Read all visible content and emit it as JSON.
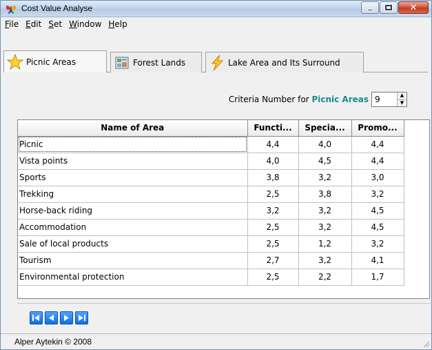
{
  "window": {
    "title": "Cost Value Analyse",
    "title_icon": "butterfly-app-icon",
    "minimize_glyph": "",
    "maximize_glyph": "",
    "close_glyph": "✕"
  },
  "menu": [
    {
      "label": "File",
      "mnemonic": "F",
      "rest": "ile"
    },
    {
      "label": "Edit",
      "mnemonic": "E",
      "rest": "dit"
    },
    {
      "label": "Set",
      "mnemonic": "S",
      "rest": "et"
    },
    {
      "label": "Window",
      "mnemonic": "W",
      "rest": "indow"
    },
    {
      "label": "Help",
      "mnemonic": "H",
      "rest": "elp"
    }
  ],
  "tabs": [
    {
      "label": "Picnic Areas",
      "icon": "star-icon",
      "active": true
    },
    {
      "label": "Forest Lands",
      "icon": "map-icon",
      "active": false
    },
    {
      "label": "Lake Area and Its Surround",
      "icon": "lightning-icon",
      "active": false
    }
  ],
  "criteria": {
    "label_prefix": "Criteria Number for",
    "label_area": "Picnic Areas",
    "value": "9",
    "accent_color": "#178c8c"
  },
  "table": {
    "columns": [
      "Name of Area",
      "Functi...",
      "Specia...",
      "Promo..."
    ],
    "rows": [
      [
        "Picnic",
        "4,4",
        "4,0",
        "4,4"
      ],
      [
        "Vista points",
        "4,0",
        "4,5",
        "4,4"
      ],
      [
        "Sports",
        "3,8",
        "3,2",
        "3,0"
      ],
      [
        "Trekking",
        "2,5",
        "3,8",
        "3,2"
      ],
      [
        "Horse-back riding",
        "3,2",
        "3,2",
        "4,5"
      ],
      [
        "Accommodation",
        "2,5",
        "3,2",
        "4,5"
      ],
      [
        "Sale of local products",
        "2,5",
        "1,2",
        "3,2"
      ],
      [
        "Tourism",
        "2,7",
        "3,2",
        "4,1"
      ],
      [
        "Environmental protection",
        "2,5",
        "2,2",
        "1,7"
      ]
    ]
  },
  "navigation": [
    {
      "name": "first-record-button",
      "icon": "first-icon"
    },
    {
      "name": "previous-record-button",
      "icon": "previous-icon"
    },
    {
      "name": "next-record-button",
      "icon": "next-icon"
    },
    {
      "name": "last-record-button",
      "icon": "last-icon"
    }
  ],
  "status": {
    "text": "Alper Aytekin © 2008"
  }
}
